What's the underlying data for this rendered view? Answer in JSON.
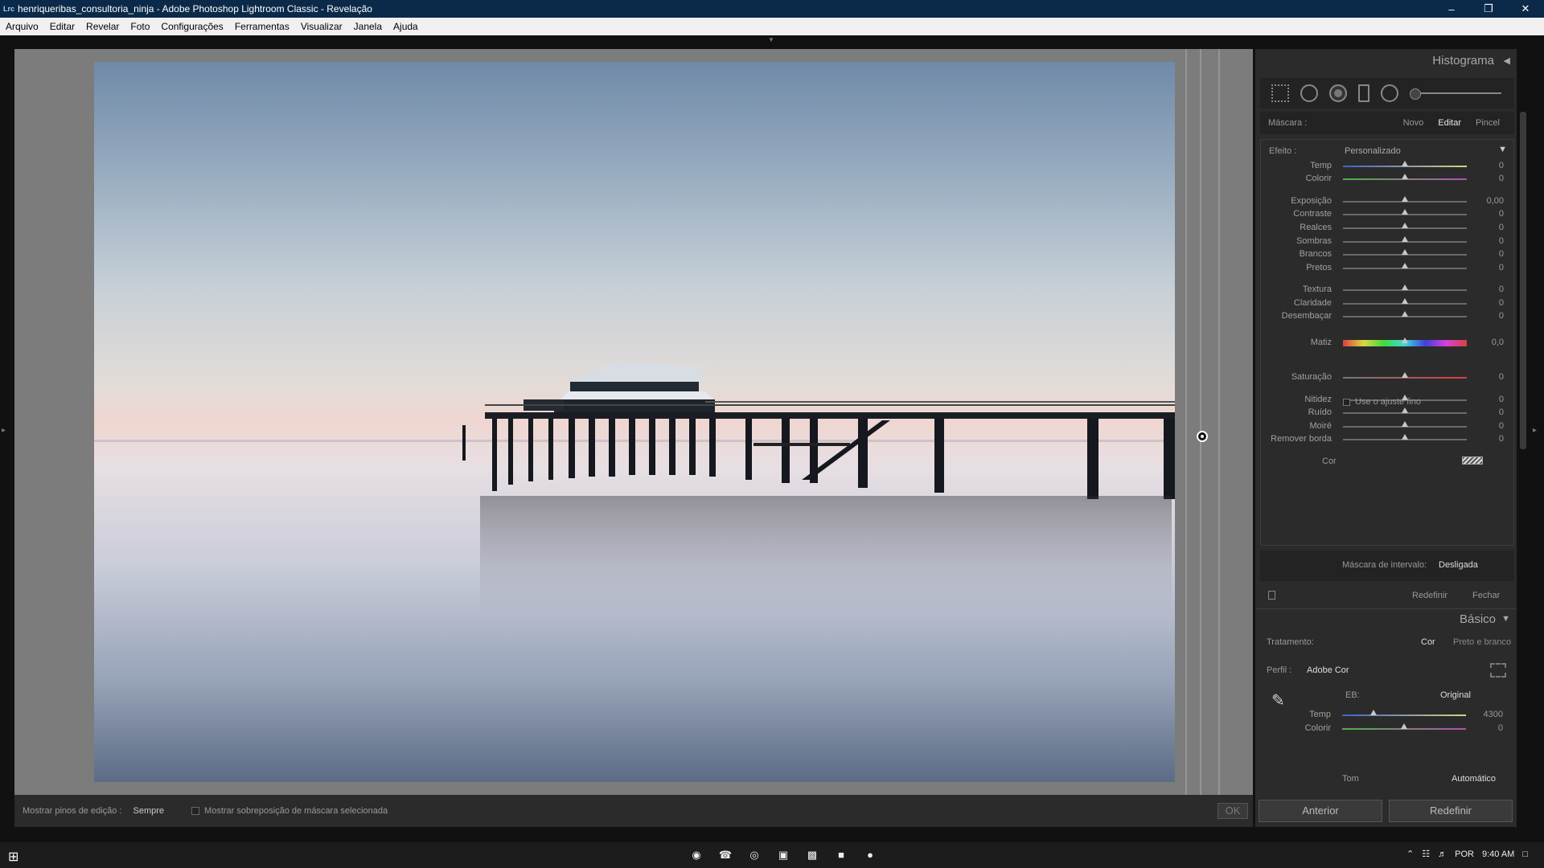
{
  "window": {
    "app_logo": "Lrc",
    "title": "henriqueribas_consultoria_ninja - Adobe Photoshop Lightroom Classic - Revelação"
  },
  "menu": [
    "Arquivo",
    "Editar",
    "Revelar",
    "Foto",
    "Configurações",
    "Ferramentas",
    "Visualizar",
    "Janela",
    "Ajuda"
  ],
  "bottom_toolbar": {
    "pins_label": "Mostrar pinos de edição :",
    "pins_value": "Sempre",
    "overlay_label": "Mostrar sobreposição de máscara selecionada",
    "ok": "OK"
  },
  "panel": {
    "histogram_title": "Histograma",
    "mask": {
      "label": "Máscara :",
      "new": "Novo",
      "edit": "Editar",
      "brush": "Pincel"
    },
    "effect": {
      "label": "Efeito :",
      "value": "Personalizado"
    },
    "sliders": [
      {
        "label": "Temp",
        "value": "0",
        "pos": 0.5,
        "style": "grad-temp"
      },
      {
        "label": "Colorir",
        "value": "0",
        "pos": 0.5,
        "style": "grad-tint"
      },
      {
        "label": "Exposição",
        "value": "0,00",
        "pos": 0.5,
        "style": ""
      },
      {
        "label": "Contraste",
        "value": "0",
        "pos": 0.5,
        "style": ""
      },
      {
        "label": "Realces",
        "value": "0",
        "pos": 0.5,
        "style": ""
      },
      {
        "label": "Sombras",
        "value": "0",
        "pos": 0.5,
        "style": ""
      },
      {
        "label": "Brancos",
        "value": "0",
        "pos": 0.5,
        "style": ""
      },
      {
        "label": "Pretos",
        "value": "0",
        "pos": 0.5,
        "style": ""
      },
      {
        "label": "Textura",
        "value": "0",
        "pos": 0.5,
        "style": ""
      },
      {
        "label": "Claridade",
        "value": "0",
        "pos": 0.5,
        "style": ""
      },
      {
        "label": "Desembaçar",
        "value": "0",
        "pos": 0.5,
        "style": ""
      },
      {
        "label": "Matiz",
        "value": "0,0",
        "pos": 0.5,
        "style": "grad-hue"
      },
      {
        "label": "Saturação",
        "value": "0",
        "pos": 0.5,
        "style": "grad-sat"
      },
      {
        "label": "Nitidez",
        "value": "0",
        "pos": 0.5,
        "style": ""
      },
      {
        "label": "Ruído",
        "value": "0",
        "pos": 0.5,
        "style": ""
      },
      {
        "label": "Moiré",
        "value": "0",
        "pos": 0.5,
        "style": ""
      },
      {
        "label": "Remover borda",
        "value": "0",
        "pos": 0.5,
        "style": ""
      }
    ],
    "fine_adjust": "Use o ajuste fino",
    "color_label": "Cor",
    "interval_mask": {
      "label": "Máscara de intervalo:",
      "value": "Desligada"
    },
    "reset": "Redefinir",
    "close": "Fechar",
    "basic": {
      "title": "Básico",
      "treatment_label": "Tratamento:",
      "treatment_color": "Cor",
      "treatment_bw": "Preto e branco",
      "profile_label": "Perfil :",
      "profile_value": "Adobe Cor",
      "wb_label": "EB:",
      "wb_value": "Original",
      "sliders": [
        {
          "label": "Temp",
          "value": "4300",
          "pos": 0.25,
          "style": "grad-temp"
        },
        {
          "label": "Colorir",
          "value": "0",
          "pos": 0.5,
          "style": "grad-tint"
        }
      ],
      "tone_label": "Tom",
      "auto": "Automático"
    },
    "prev_button": "Anterior",
    "reset_button": "Redefinir"
  },
  "taskbar": {
    "lang": "POR",
    "time": "9:40 AM"
  }
}
